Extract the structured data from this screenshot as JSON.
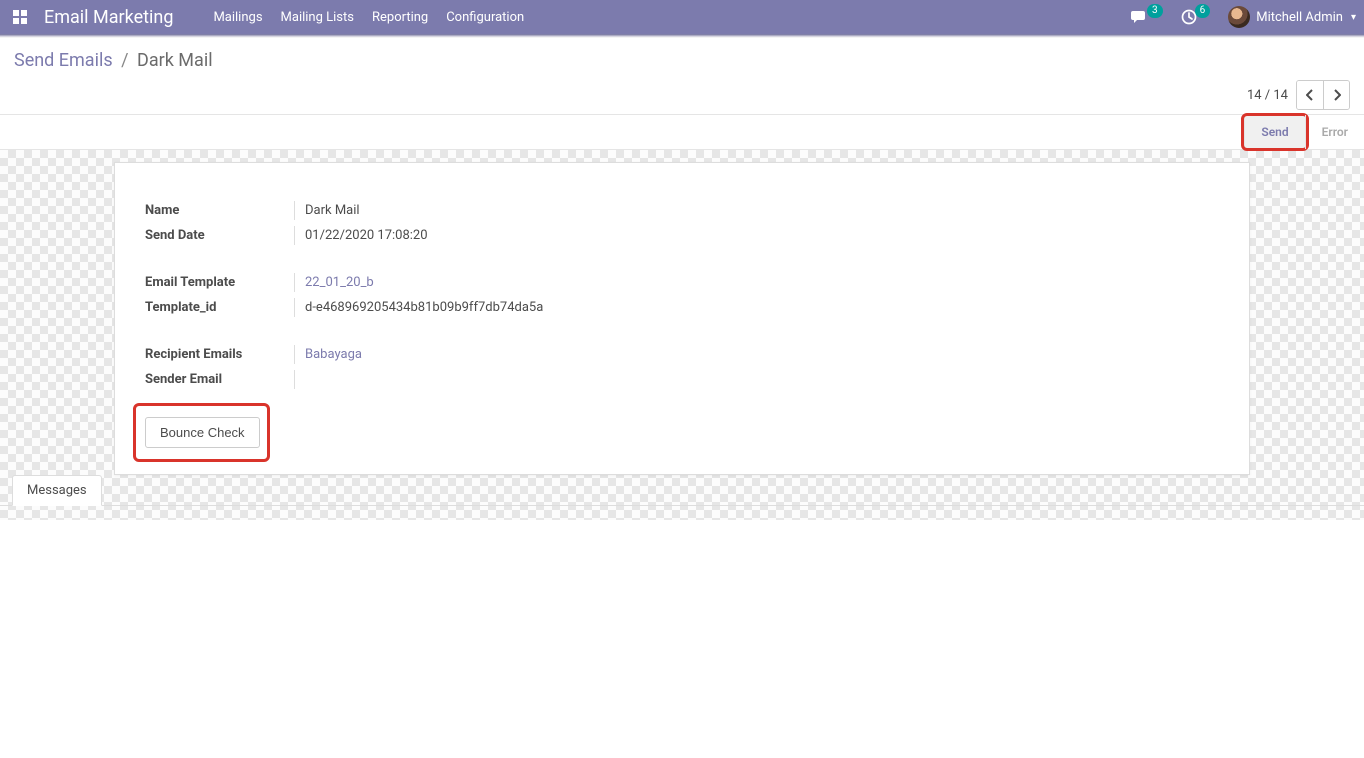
{
  "navbar": {
    "brand": "Email Marketing",
    "menu": [
      "Mailings",
      "Mailing Lists",
      "Reporting",
      "Configuration"
    ],
    "messages_badge": "3",
    "activities_badge": "6",
    "user_name": "Mitchell Admin"
  },
  "breadcrumb": {
    "parent": "Send Emails",
    "sep": "/",
    "current": "Dark Mail"
  },
  "pager": {
    "text": "14 / 14"
  },
  "statusbar": {
    "send": "Send",
    "error": "Error"
  },
  "form": {
    "labels": {
      "name": "Name",
      "send_date": "Send Date",
      "email_template": "Email Template",
      "template_id": "Template_id",
      "recipient_emails": "Recipient Emails",
      "sender_email": "Sender Email"
    },
    "values": {
      "name": "Dark Mail",
      "send_date": "01/22/2020 17:08:20",
      "email_template": "22_01_20_b",
      "template_id": "d-e468969205434b81b09b9ff7db74da5a",
      "recipient_emails": "Babayaga",
      "sender_email": ""
    },
    "bounce_check": "Bounce Check"
  },
  "tabs": {
    "messages": "Messages"
  }
}
